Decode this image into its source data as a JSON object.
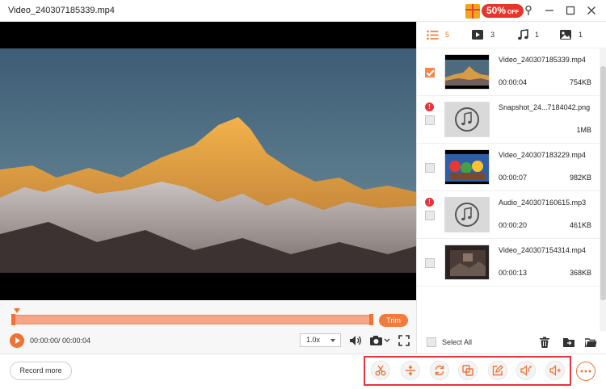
{
  "window": {
    "title": "Video_240307185339.mp4",
    "promo_percent": "50%",
    "promo_off": "OFF"
  },
  "player": {
    "time": "00:00:00/ 00:00:04",
    "speed": "1.0x",
    "trim_label": "Trim"
  },
  "bottom": {
    "record_more": "Record more",
    "tools": [
      {
        "name": "scissors-icon",
        "label": "Trim"
      },
      {
        "name": "compress-icon",
        "label": "Compress"
      },
      {
        "name": "convert-icon",
        "label": "Convert"
      },
      {
        "name": "merge-icon",
        "label": "Merge"
      },
      {
        "name": "edit-icon",
        "label": "Edit"
      },
      {
        "name": "volume-adjust-icon",
        "label": "Volume"
      },
      {
        "name": "audio-enhance-icon",
        "label": "Audio"
      }
    ]
  },
  "panel": {
    "filters": [
      {
        "icon": "list-icon",
        "count": "5"
      },
      {
        "icon": "video-icon",
        "count": "3"
      },
      {
        "icon": "music-icon",
        "count": "1"
      },
      {
        "icon": "image-icon",
        "count": "1"
      }
    ],
    "files": [
      {
        "name": "Video_240307185339.mp4",
        "duration": "00:00:04",
        "size": "754KB"
      },
      {
        "name": "Snapshot_24...7184042.png",
        "duration": "",
        "size": "1MB"
      },
      {
        "name": "Video_240307183229.mp4",
        "duration": "00:00:07",
        "size": "982KB"
      },
      {
        "name": "Audio_240307160615.mp3",
        "duration": "00:00:20",
        "size": "461KB"
      },
      {
        "name": "Video_240307154314.mp4",
        "duration": "00:00:13",
        "size": "368KB"
      }
    ],
    "select_all": "Select All"
  },
  "colors": {
    "accent": "#f07235",
    "highlight_border": "#e8333d"
  }
}
